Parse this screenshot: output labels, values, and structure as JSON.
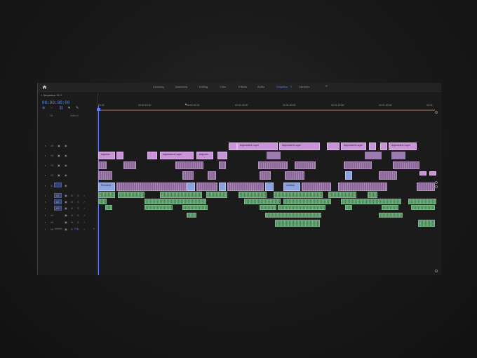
{
  "topbar": {
    "tabs": [
      {
        "label": "Learning",
        "active": false
      },
      {
        "label": "Assembly",
        "active": false
      },
      {
        "label": "Editing",
        "active": false
      },
      {
        "label": "Color",
        "active": false
      },
      {
        "label": "Effects",
        "active": false
      },
      {
        "label": "Audio",
        "active": false
      },
      {
        "label": "Graphics",
        "active": true
      },
      {
        "label": "Libraries",
        "active": false
      }
    ],
    "more": "»"
  },
  "sequence": {
    "tab_label": "Sequence 01",
    "close": "≡",
    "timecode": "00:00:00:00"
  },
  "ruler": {
    "ticks": [
      "00:00",
      "00:00:15:00",
      "00:00:30:00",
      "00:00:45:00",
      "00:01:00:00",
      "00:01:15:00",
      "00:01:30:00",
      "00:01:"
    ]
  },
  "tracks": {
    "video": [
      {
        "id": "V6",
        "name": "Video 6"
      },
      {
        "id": "V5"
      },
      {
        "id": "V4"
      },
      {
        "id": "V3"
      },
      {
        "id": "V2"
      },
      {
        "id": "V1"
      }
    ],
    "audio": [
      {
        "id": "A1",
        "m": "M",
        "s": "S"
      },
      {
        "id": "A2",
        "m": "M",
        "s": "S"
      },
      {
        "id": "A3",
        "m": "M",
        "s": "S"
      },
      {
        "id": "A4",
        "m": "M",
        "s": "S"
      },
      {
        "id": "A5",
        "m": "M",
        "s": "S"
      },
      {
        "id": "A6",
        "m": "M",
        "s": "S"
      }
    ],
    "master": {
      "label": "Master",
      "value": "0.0"
    }
  },
  "clips": {
    "adjustment_label": "Adjustment Layer",
    "adjustment_short": "Adjustm",
    "v1_label": "Premiere",
    "v1_label2": "Untitled"
  },
  "colors": {
    "accent": "#5a7cff",
    "adjustment": "#c993d8",
    "video": "#8a6698",
    "audio": "#4f8a5c",
    "graphic": "#8ea2e0"
  }
}
